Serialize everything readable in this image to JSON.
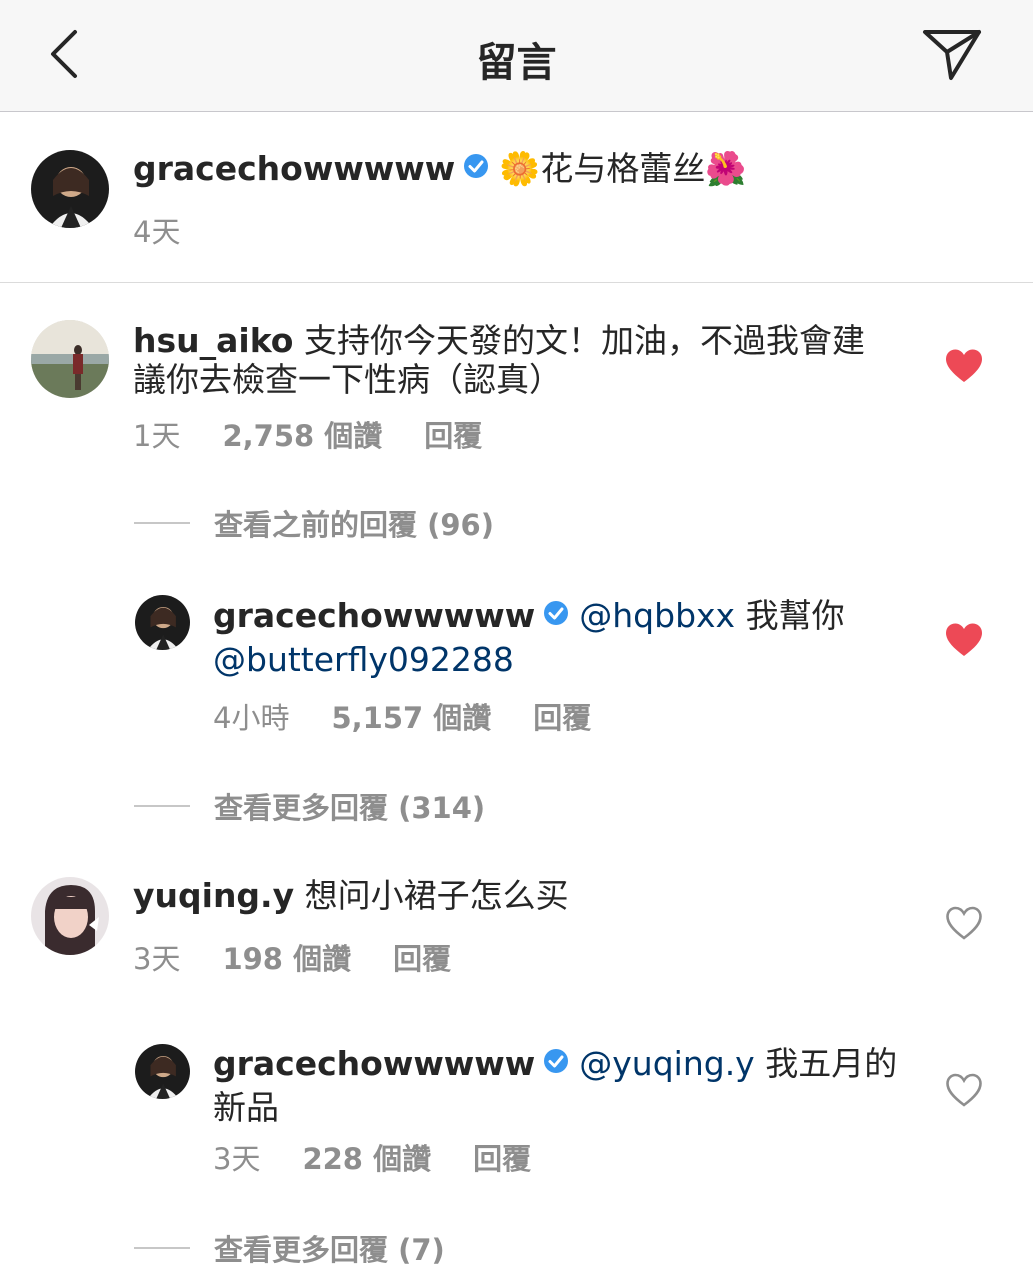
{
  "header": {
    "title": "留言"
  },
  "caption": {
    "username": "gracechowwwww",
    "emoji_start": "🌼",
    "text": "花与格蕾丝",
    "emoji_end": "🌺",
    "time": "4天"
  },
  "comments": [
    {
      "username": "hsu_aiko",
      "text_line1": "支持你今天發的文！加油，不過我會建",
      "text_line2": "議你去檢查一下性病（認真）",
      "time": "1天",
      "likes": "2,758 個讚",
      "reply": "回覆",
      "liked": true
    },
    {
      "view_replies": "查看之前的回覆 (96)"
    },
    {
      "username": "gracechowwwww",
      "mention1": "@hqbbxx",
      "text": "我幫你",
      "mention2": "@butterfly092288",
      "time": "4小時",
      "likes": "5,157 個讚",
      "reply": "回覆",
      "liked": true
    },
    {
      "view_replies": "查看更多回覆 (314)"
    },
    {
      "username": "yuqing.y",
      "text": "想问小裙子怎么买",
      "time": "3天",
      "likes": "198 個讚",
      "reply": "回覆",
      "liked": false
    },
    {
      "username": "gracechowwwww",
      "mention1": "@yuqing.y",
      "text_line1": "我五月的",
      "text_line2": "新品",
      "time": "3天",
      "likes": "228 個讚",
      "reply": "回覆",
      "liked": false
    },
    {
      "view_replies": "查看更多回覆 (7)"
    }
  ],
  "colors": {
    "heart_filled": "#ed4956",
    "verified_badge": "#3897f0",
    "mention": "#003569",
    "meta_gray": "#8e8e8e"
  },
  "icons": [
    "back-chevron-icon",
    "send-direct-icon",
    "verified-badge-icon",
    "heart-filled-icon",
    "heart-outline-icon"
  ]
}
